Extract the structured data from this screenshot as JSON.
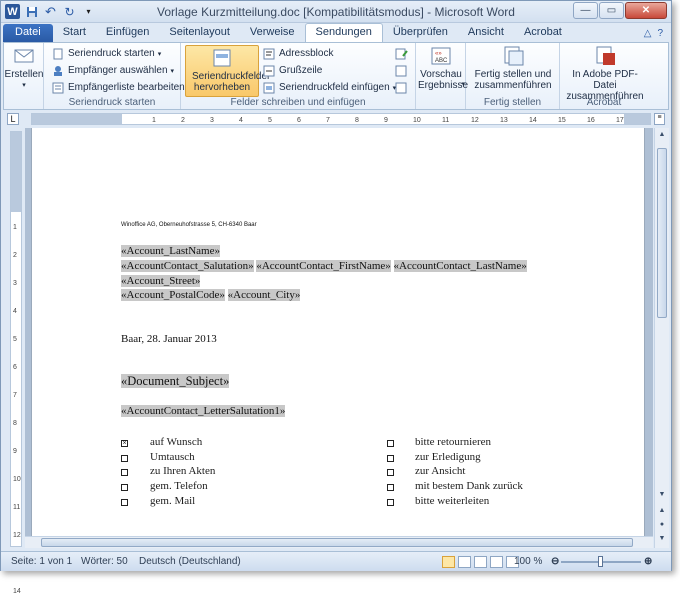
{
  "window": {
    "title": "Vorlage Kurzmitteilung.doc [Kompatibilitätsmodus] - Microsoft Word"
  },
  "qat": {
    "logo": "W",
    "save_icon": "save-icon",
    "undo": "↶",
    "redo": "↻"
  },
  "tabs": [
    "Datei",
    "Start",
    "Einfügen",
    "Seitenlayout",
    "Verweise",
    "Sendungen",
    "Überprüfen",
    "Ansicht",
    "Acrobat"
  ],
  "ribbon": {
    "erstellen": {
      "label": "Erstellen"
    },
    "seriendruck": {
      "start": "Seriendruck starten",
      "empf": "Empfänger auswählen",
      "liste": "Empfängerliste bearbeiten",
      "group": "Seriendruck starten"
    },
    "felder": {
      "hervor": "Seriendruckfelder hervorheben",
      "adress": "Adressblock",
      "gruss": "Grußzeile",
      "einf": "Seriendruckfeld einfügen",
      "group": "Felder schreiben und einfügen"
    },
    "vorschau": {
      "label": "Vorschau Ergebnisse"
    },
    "fertig": {
      "label": "Fertig stellen und zusammenführen",
      "group": "Fertig stellen"
    },
    "acrobat": {
      "label": "In Adobe PDF-Datei zusammenführen",
      "group": "Acrobat"
    }
  },
  "ruler": {
    "box": "L",
    "ticks": [
      "1",
      "2",
      "3",
      "4",
      "5",
      "6",
      "7",
      "8",
      "9",
      "10",
      "11",
      "12",
      "13",
      "14",
      "15",
      "16",
      "17"
    ]
  },
  "doc": {
    "sender": "Winoffice AG, Oberneuhofstrasse  5, CH-6340  Baar",
    "f_lastname": "«Account_LastName»",
    "f_salutation": "«AccountContact_Salutation»",
    "f_firstname": "«AccountContact_FirstName»",
    "f_contact_lastname": "«AccountContact_LastName»",
    "f_street": "«Account_Street»",
    "f_postal": "«Account_PostalCode»",
    "f_city": "«Account_City»",
    "date": "Baar, 28. Januar 2013",
    "subject": "«Document_Subject»",
    "letter_salutation": "«AccountContact_LetterSalutation1»",
    "checkboxes_left": [
      {
        "label": "auf Wunsch",
        "checked": true
      },
      {
        "label": "Umtausch",
        "checked": false
      },
      {
        "label": "zu Ihren Akten",
        "checked": false
      },
      {
        "label": "gem. Telefon",
        "checked": false
      },
      {
        "label": "gem. Mail",
        "checked": false
      }
    ],
    "checkboxes_right": [
      {
        "label": "bitte retournieren",
        "checked": false
      },
      {
        "label": "zur Erledigung",
        "checked": false
      },
      {
        "label": "zur Ansicht",
        "checked": false
      },
      {
        "label": "mit bestem Dank zurück",
        "checked": false
      },
      {
        "label": "bitte weiterleiten",
        "checked": false
      }
    ]
  },
  "status": {
    "page": "Seite: 1 von 1",
    "words": "Wörter: 50",
    "lang": "Deutsch (Deutschland)",
    "zoom": "100 %"
  }
}
